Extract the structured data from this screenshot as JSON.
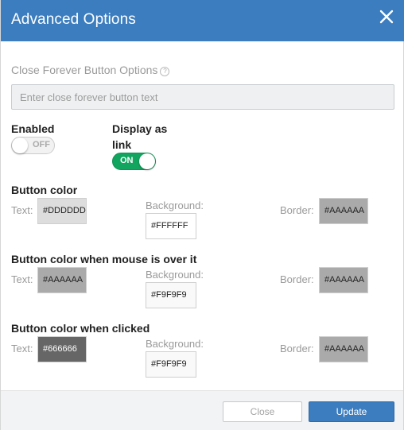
{
  "header": {
    "title": "Advanced Options",
    "color": "#3b7dbf"
  },
  "close_forever": {
    "section_label": "Close Forever Button Options",
    "help_icon": "question-circle-icon",
    "input_placeholder": "Enter close forever button text",
    "input_value": ""
  },
  "toggles": {
    "enabled": {
      "label": "Enabled",
      "state": "OFF"
    },
    "display_as_link": {
      "label": "Display as link",
      "state": "ON"
    }
  },
  "color_groups": [
    {
      "title": "Button color",
      "text_label": "Text:",
      "text_value": "#DDDDDD",
      "text_color": "#DDDDDD",
      "background_label": "Background:",
      "background_value": "#FFFFFF",
      "background_color": "#FFFFFF",
      "border_label": "Border:",
      "border_value": "#AAAAAA",
      "border_color": "#AAAAAA"
    },
    {
      "title": "Button color when mouse is over it",
      "text_label": "Text:",
      "text_value": "#AAAAAA",
      "text_color": "#AAAAAA",
      "background_label": "Background:",
      "background_value": "#F9F9F9",
      "background_color": "#F9F9F9",
      "border_label": "Border:",
      "border_value": "#AAAAAA",
      "border_color": "#AAAAAA"
    },
    {
      "title": "Button color when clicked",
      "text_label": "Text:",
      "text_value": "#666666",
      "text_color": "#666666",
      "background_label": "Background:",
      "background_value": "#F9F9F9",
      "background_color": "#F9F9F9",
      "border_label": "Border:",
      "border_value": "#AAAAAA",
      "border_color": "#AAAAAA"
    }
  ],
  "footer": {
    "close_label": "Close",
    "update_label": "Update"
  }
}
